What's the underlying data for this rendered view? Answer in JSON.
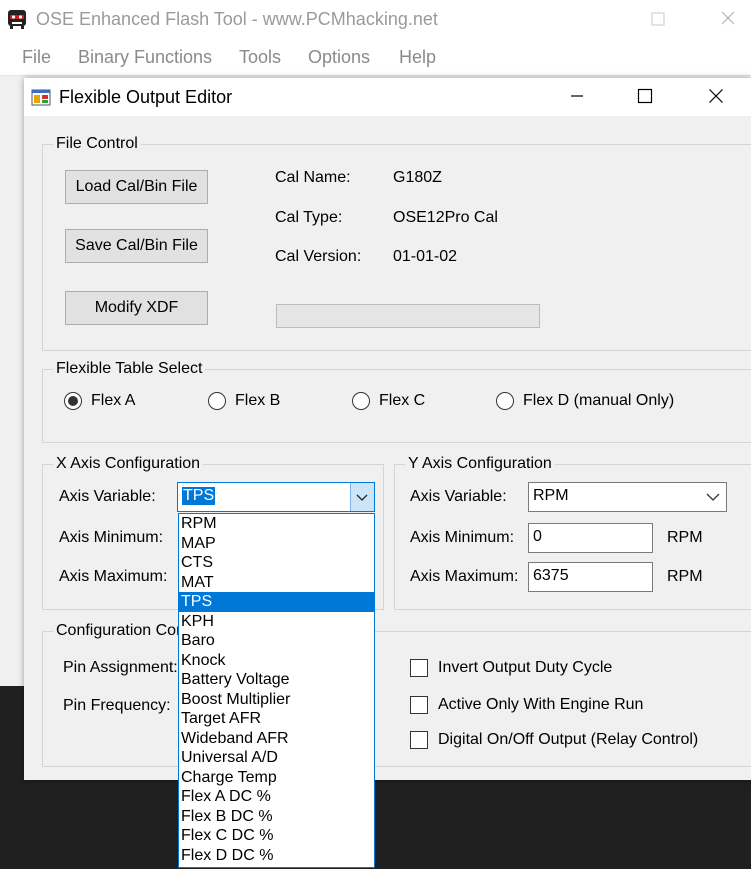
{
  "main_window": {
    "title": "OSE Enhanced Flash Tool - www.PCMhacking.net",
    "menu": [
      "File",
      "Binary Functions",
      "Tools",
      "Options",
      "Help"
    ]
  },
  "editor": {
    "title": "Flexible Output Editor",
    "file_control": {
      "legend": "File Control",
      "load_button": "Load Cal/Bin File",
      "save_button": "Save Cal/Bin File",
      "modify_button": "Modify XDF",
      "cal_name_label": "Cal Name:",
      "cal_name_value": "G180Z",
      "cal_type_label": "Cal Type:",
      "cal_type_value": "OSE12Pro Cal",
      "cal_version_label": "Cal Version:",
      "cal_version_value": "01-01-02",
      "progress": 0
    },
    "table_select": {
      "legend": "Flexible Table Select",
      "options": [
        "Flex A",
        "Flex B",
        "Flex C",
        "Flex D (manual Only)"
      ],
      "selected_index": 0
    },
    "x_axis": {
      "legend": "X Axis Configuration",
      "variable_label": "Axis Variable:",
      "variable_value": "TPS",
      "min_label": "Axis Minimum:",
      "max_label": "Axis Maximum:"
    },
    "y_axis": {
      "legend": "Y Axis Configuration",
      "variable_label": "Axis Variable:",
      "variable_value": "RPM",
      "min_label": "Axis Minimum:",
      "min_value": "0",
      "min_unit": "RPM",
      "max_label": "Axis Maximum:",
      "max_value": "6375",
      "max_unit": "RPM"
    },
    "config": {
      "legend": "Configuration Con",
      "pin_assignment_label": "Pin Assignment:",
      "pin_frequency_label": "Pin Frequency:",
      "invert_label": "Invert Output Duty Cycle",
      "active_label": "Active Only With Engine Run",
      "digital_label": "Digital On/Off Output (Relay Control)"
    },
    "dropdown": {
      "items": [
        "RPM",
        "MAP",
        "CTS",
        "MAT",
        "TPS",
        "KPH",
        "Baro",
        "Knock",
        "Battery Voltage",
        "Boost Multiplier",
        "Target AFR",
        "Wideband AFR",
        "Universal A/D",
        "Charge Temp",
        "Flex A DC %",
        "Flex B DC %",
        "Flex C DC %",
        "Flex D DC %"
      ],
      "selected_index": 4
    }
  }
}
